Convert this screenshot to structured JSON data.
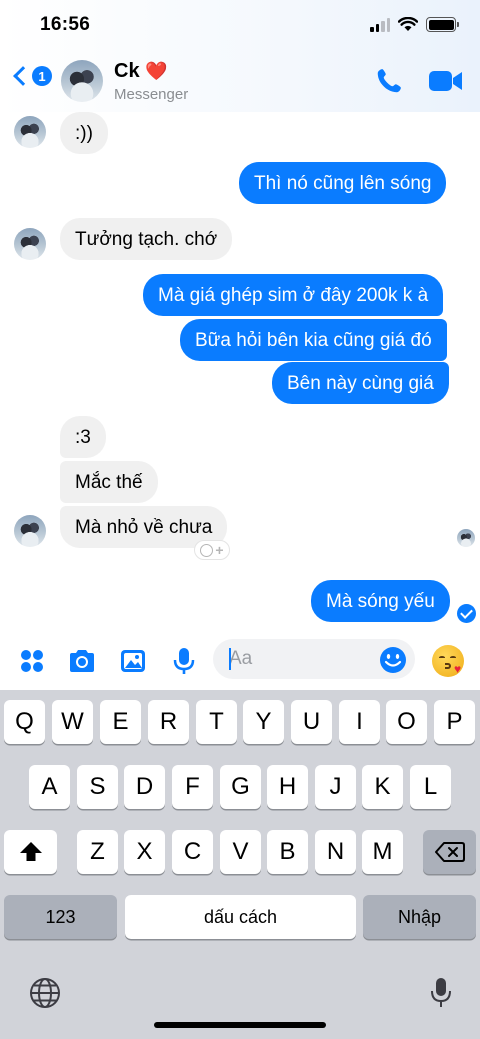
{
  "status_bar": {
    "time": "16:56"
  },
  "header": {
    "back_badge": "1",
    "contact_name": "Ck",
    "name_emoji": "❤️",
    "subtitle": "Messenger",
    "icons": [
      "back-chevron-icon",
      "phone-call-icon",
      "video-call-icon"
    ]
  },
  "messages": [
    {
      "from": "them",
      "text": ":))"
    },
    {
      "from": "me",
      "text": "Thì nó cũng lên sóng"
    },
    {
      "from": "them",
      "text": "Tưởng tạch. chớ"
    },
    {
      "from": "me",
      "text": "Mà giá ghép sim ở đây 200k k à"
    },
    {
      "from": "me",
      "text": "Bữa hỏi bên kia cũng giá đó"
    },
    {
      "from": "me",
      "text": "Bên này cùng giá"
    },
    {
      "from": "them",
      "text": ":3"
    },
    {
      "from": "them",
      "text": "Mắc thế"
    },
    {
      "from": "them",
      "text": "Mà nhỏ về chưa"
    },
    {
      "from": "me",
      "text": "Mà sóng yếu"
    }
  ],
  "composer": {
    "placeholder": "Aa",
    "icons": [
      "apps-grid-icon",
      "camera-icon",
      "gallery-icon",
      "microphone-icon",
      "emoji-icon",
      "kiss-sticker-icon"
    ]
  },
  "keyboard": {
    "row1": [
      "Q",
      "W",
      "E",
      "R",
      "T",
      "Y",
      "U",
      "I",
      "O",
      "P"
    ],
    "row2": [
      "A",
      "S",
      "D",
      "F",
      "G",
      "H",
      "J",
      "K",
      "L"
    ],
    "row3": [
      "Z",
      "X",
      "C",
      "V",
      "B",
      "N",
      "M"
    ],
    "numbers_key": "123",
    "space_key": "dấu cách",
    "return_key": "Nhập"
  },
  "colors": {
    "accent": "#0a7cff",
    "incoming_bubble": "#f0f0f0",
    "keyboard_bg": "#d1d3d9"
  }
}
